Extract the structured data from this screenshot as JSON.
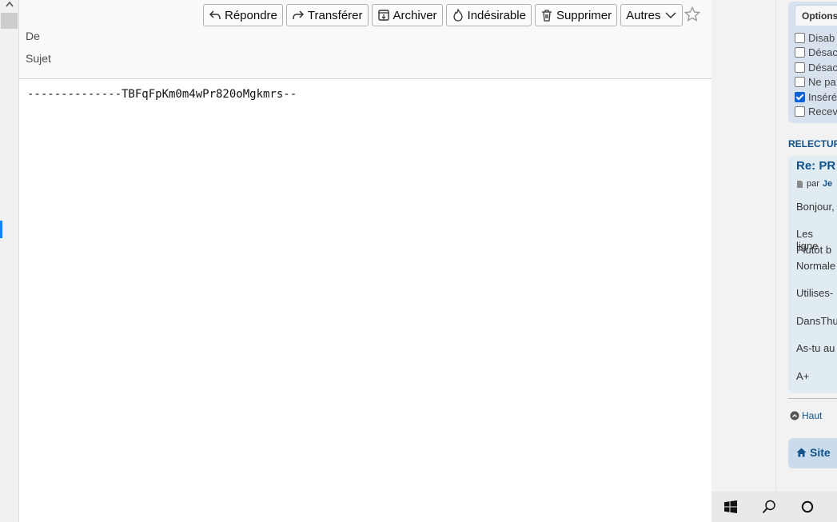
{
  "toolbar": {
    "reply": "Répondre",
    "forward": "Transférer",
    "archive": "Archiver",
    "junk": "Indésirable",
    "delete": "Supprimer",
    "more": "Autres"
  },
  "header": {
    "from_label": "De",
    "subject_label": "Sujet"
  },
  "body": {
    "text": "--------------TBFqFpKm0m4wPr820oMgkmrs--"
  },
  "sidebar": {
    "options_tab": "Options",
    "options": [
      {
        "label": "Disab",
        "checked": false
      },
      {
        "label": "Désac",
        "checked": false
      },
      {
        "label": "Désac",
        "checked": false
      },
      {
        "label": "Ne pa",
        "checked": false
      },
      {
        "label": "Inséré",
        "checked": true
      },
      {
        "label": "Recev",
        "checked": false
      }
    ],
    "section_title": "RELECTUR",
    "post_title": "Re: PR",
    "post_meta_prefix": "par",
    "post_meta_author": "Je",
    "post_lines": [
      "Bonjour,",
      "Les ligne",
      "Plutôt b",
      "Normale",
      "Utilises-",
      "DansThu",
      "As-tu au",
      "A+"
    ],
    "top_link": "Haut",
    "site_label": "Site"
  },
  "colors": {
    "link": "#105289",
    "accent": "#0a84ff"
  }
}
